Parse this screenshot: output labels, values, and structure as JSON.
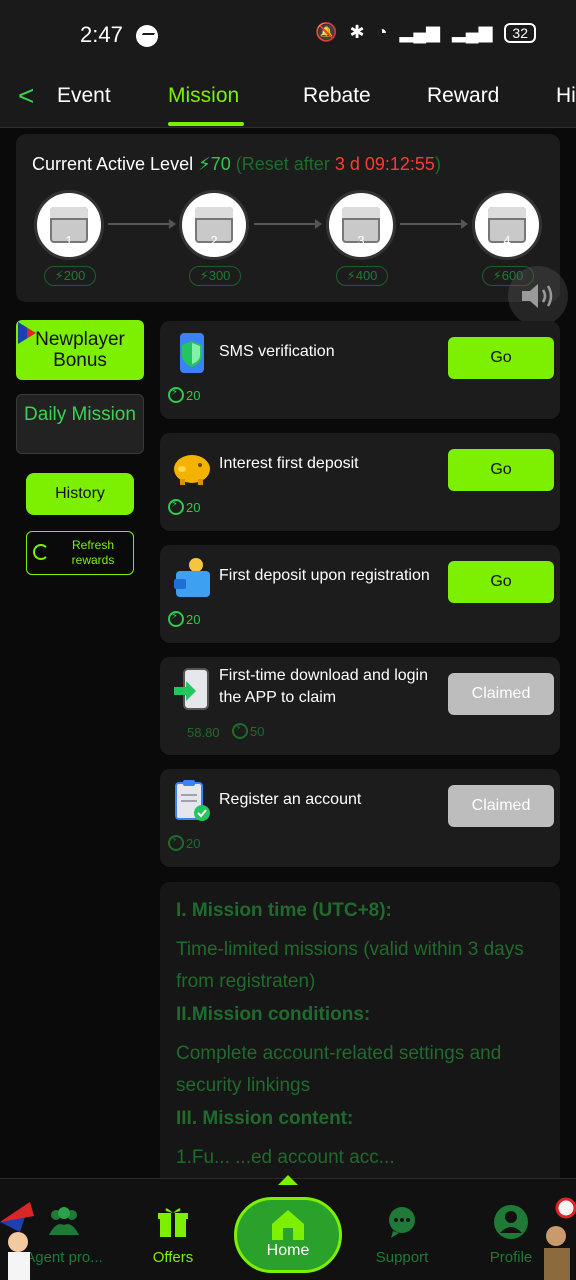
{
  "status_bar": {
    "time": "2:47",
    "battery": "32"
  },
  "tabs": [
    {
      "label": "Event"
    },
    {
      "label": "Mission"
    },
    {
      "label": "Rebate"
    },
    {
      "label": "Reward"
    },
    {
      "label": "Hi"
    }
  ],
  "level": {
    "label": "Current Active Level",
    "points": "70",
    "reset_prefix": "(Reset after",
    "countdown": "3 d 09:12:55",
    "reset_suffix": ")",
    "chests": [
      {
        "num": "1",
        "points": "200"
      },
      {
        "num": "2",
        "points": "300"
      },
      {
        "num": "3",
        "points": "400"
      },
      {
        "num": "4",
        "points": "600"
      }
    ]
  },
  "sidebar": {
    "newplayer": "Newplayer Bonus",
    "daily": "Daily Mission",
    "history": "History",
    "refresh": "Refresh rewards"
  },
  "missions": [
    {
      "title": "SMS verification",
      "points": "20",
      "button": "Go",
      "state": "go"
    },
    {
      "title": "Interest first deposit",
      "points": "20",
      "button": "Go",
      "state": "go"
    },
    {
      "title": "First deposit upon registration",
      "points": "20",
      "button": "Go",
      "state": "go"
    },
    {
      "title": "First-time download and login the APP to claim",
      "money": "58.80",
      "points": "50",
      "button": "Claimed",
      "state": "claimed"
    },
    {
      "title": "Register an account",
      "points": "20",
      "button": "Claimed",
      "state": "claimed"
    }
  ],
  "rules": {
    "h1": "I. Mission time (UTC+8):",
    "p1": "Time-limited missions (valid within 3 days from registraten)",
    "h2": "II.Mission conditions:",
    "p2": "Complete account-related settings and security linkings",
    "h3": "III. Mission content:",
    "p3": "1.Fu... ...ed account acc..."
  },
  "bottom_nav": [
    {
      "label": "Agent pro...",
      "icon": "agent-icon"
    },
    {
      "label": "Offers",
      "icon": "gift-icon"
    },
    {
      "label": "Home",
      "icon": "home-icon"
    },
    {
      "label": "Support",
      "icon": "support-icon"
    },
    {
      "label": "Profile",
      "icon": "profile-icon"
    }
  ],
  "colors": {
    "accent": "#7cf000",
    "green": "#2ec84f",
    "dark_green": "#1e6b2e",
    "countdown": "#ff3b30",
    "bg": "#0a0a0a",
    "card": "#1c1c1c"
  }
}
